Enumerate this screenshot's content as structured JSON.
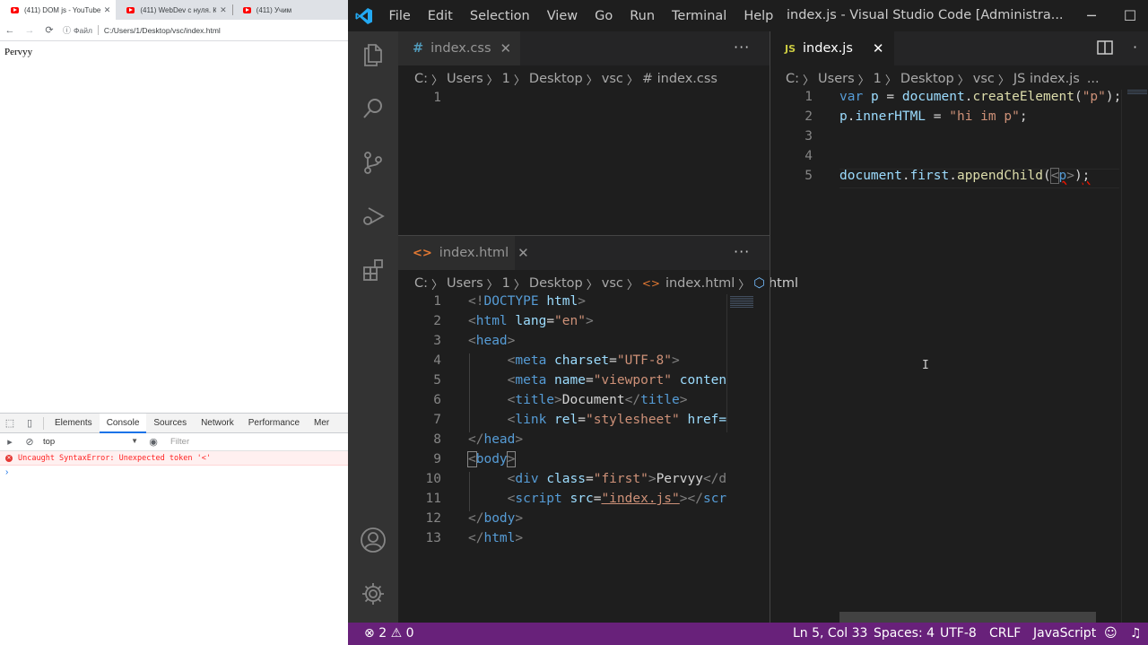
{
  "browser": {
    "tabs": [
      {
        "title": "(411) DOM js - YouTube"
      },
      {
        "title": "(411) WebDev с нуля. Канал Ал"
      },
      {
        "title": "(411) Учим"
      }
    ],
    "address": {
      "info_label": "Файл",
      "url": "C:/Users/1/Desktop/vsc/index.html"
    },
    "page_text": "Pervyy",
    "devtools": {
      "tabs": [
        "Elements",
        "Console",
        "Sources",
        "Network",
        "Performance",
        "Mer"
      ],
      "active_tab": "Console",
      "context": "top",
      "filter_placeholder": "Filter",
      "error": "Uncaught SyntaxError: Unexpected token '<'",
      "prompt": "›"
    }
  },
  "vscode": {
    "menu": [
      "File",
      "Edit",
      "Selection",
      "View",
      "Go",
      "Run",
      "Terminal",
      "Help"
    ],
    "window_title": "index.js - Visual Studio Code [Administra...",
    "css_group": {
      "tab": {
        "icon": "#",
        "label": "index.css"
      },
      "breadcrumb": [
        "C:",
        "Users",
        "1",
        "Desktop",
        "vsc",
        "# index.css"
      ],
      "line_numbers": [
        "1"
      ]
    },
    "html_group": {
      "tab": {
        "icon": "<>",
        "label": "index.html"
      },
      "breadcrumb": [
        "C:",
        "Users",
        "1",
        "Desktop",
        "vsc",
        "index.html",
        "html"
      ],
      "line_numbers": [
        "1",
        "2",
        "3",
        "4",
        "5",
        "6",
        "7",
        "8",
        "9",
        "10",
        "11",
        "12",
        "13"
      ]
    },
    "js_group": {
      "tab": {
        "icon": "JS",
        "label": "index.js"
      },
      "breadcrumb": [
        "C:",
        "Users",
        "1",
        "Desktop",
        "vsc",
        "JS index.js",
        "..."
      ],
      "line_numbers": [
        "1",
        "2",
        "3",
        "4",
        "5"
      ]
    },
    "status": {
      "errors": "2",
      "warnings": "0",
      "position": "Ln 5, Col 33",
      "spaces": "Spaces: 4",
      "encoding": "UTF-8",
      "eol": "CRLF",
      "language": "JavaScript"
    },
    "colors": {
      "statusbar": "#68217a",
      "activitybar": "#333333",
      "editor": "#1e1e1e"
    }
  }
}
